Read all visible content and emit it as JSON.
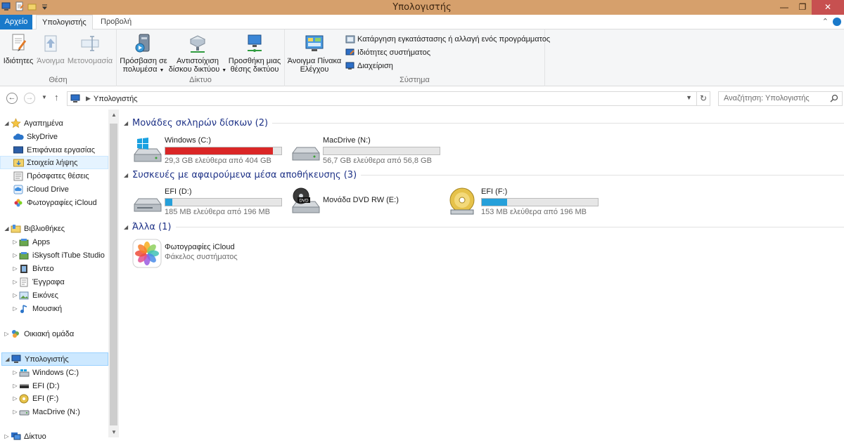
{
  "window": {
    "title": "Υπολογιστής"
  },
  "ribbon_tabs": {
    "file": "Αρχείο",
    "computer": "Υπολογιστής",
    "view": "Προβολή"
  },
  "ribbon": {
    "location": {
      "label": "Θέση",
      "properties": "Ιδιότητες",
      "open": "Άνοιγμα",
      "rename": "Μετονομασία"
    },
    "network": {
      "label": "Δίκτυο",
      "media_line1": "Πρόσβαση σε",
      "media_line2": "πολυμέσα",
      "map_line1": "Αντιστοίχιση",
      "map_line2": "δίσκου δικτύου",
      "add_line1": "Προσθήκη μιας",
      "add_line2": "θέσης δικτύου"
    },
    "system": {
      "label": "Σύστημα",
      "cp_line1": "Άνοιγμα Πίνακα",
      "cp_line2": "Ελέγχου",
      "uninstall": "Κατάργηση εγκατάστασης ή αλλαγή ενός προγράμματος",
      "sysprops": "Ιδιότητες συστήματος",
      "manage": "Διαχείριση"
    }
  },
  "address": {
    "path": "Υπολογιστής",
    "search_placeholder": "Αναζήτηση: Υπολογιστής"
  },
  "nav": {
    "favorites": "Αγαπημένα",
    "skydrive": "SkyDrive",
    "desktop": "Επιφάνεια εργασίας",
    "downloads": "Στοιχεία λήψης",
    "recent": "Πρόσφατες θέσεις",
    "icloud_drive": "iCloud Drive",
    "icloud_photos": "Φωτογραφίες iCloud",
    "libraries": "Βιβλιοθήκες",
    "apps": "Apps",
    "iskysoft": "iSkysoft iTube Studio",
    "video": "Βίντεο",
    "documents": "Έγγραφα",
    "pictures": "Εικόνες",
    "music": "Μουσική",
    "homegroup": "Οικιακή ομάδα",
    "computer": "Υπολογιστής",
    "windows_c": "Windows (C:)",
    "efi_d": "EFI (D:)",
    "efi_f": "EFI (F:)",
    "macdrive": "MacDrive (N:)",
    "network": "Δίκτυο"
  },
  "groups": {
    "hdd": "Μονάδες σκληρών δίσκων (2)",
    "removable": "Συσκευές με αφαιρούμενα μέσα αποθήκευσης (3)",
    "other": "Άλλα (1)"
  },
  "drives": {
    "c": {
      "name": "Windows (C:)",
      "free": "29,3 GB ελεύθερα από 404 GB",
      "used_fraction": 0.93,
      "bar_color": "#da2626"
    },
    "n": {
      "name": "MacDrive (N:)",
      "free": "56,7 GB ελεύθερα από 56,8 GB",
      "used_fraction": 0.0,
      "bar_color": "#26a0da"
    },
    "d": {
      "name": "EFI (D:)",
      "free": "185 MB ελεύθερα από 196 MB",
      "used_fraction": 0.06,
      "bar_color": "#26a0da"
    },
    "e": {
      "name": "Μονάδα DVD RW (E:)"
    },
    "f": {
      "name": "EFI (F:)",
      "free": "153 MB ελεύθερα από 196 MB",
      "used_fraction": 0.22,
      "bar_color": "#26a0da"
    },
    "icloud": {
      "name": "Φωτογραφίες iCloud",
      "sub": "Φάκελος συστήματος"
    }
  },
  "icons": {
    "dvd_badge": "DVD"
  }
}
